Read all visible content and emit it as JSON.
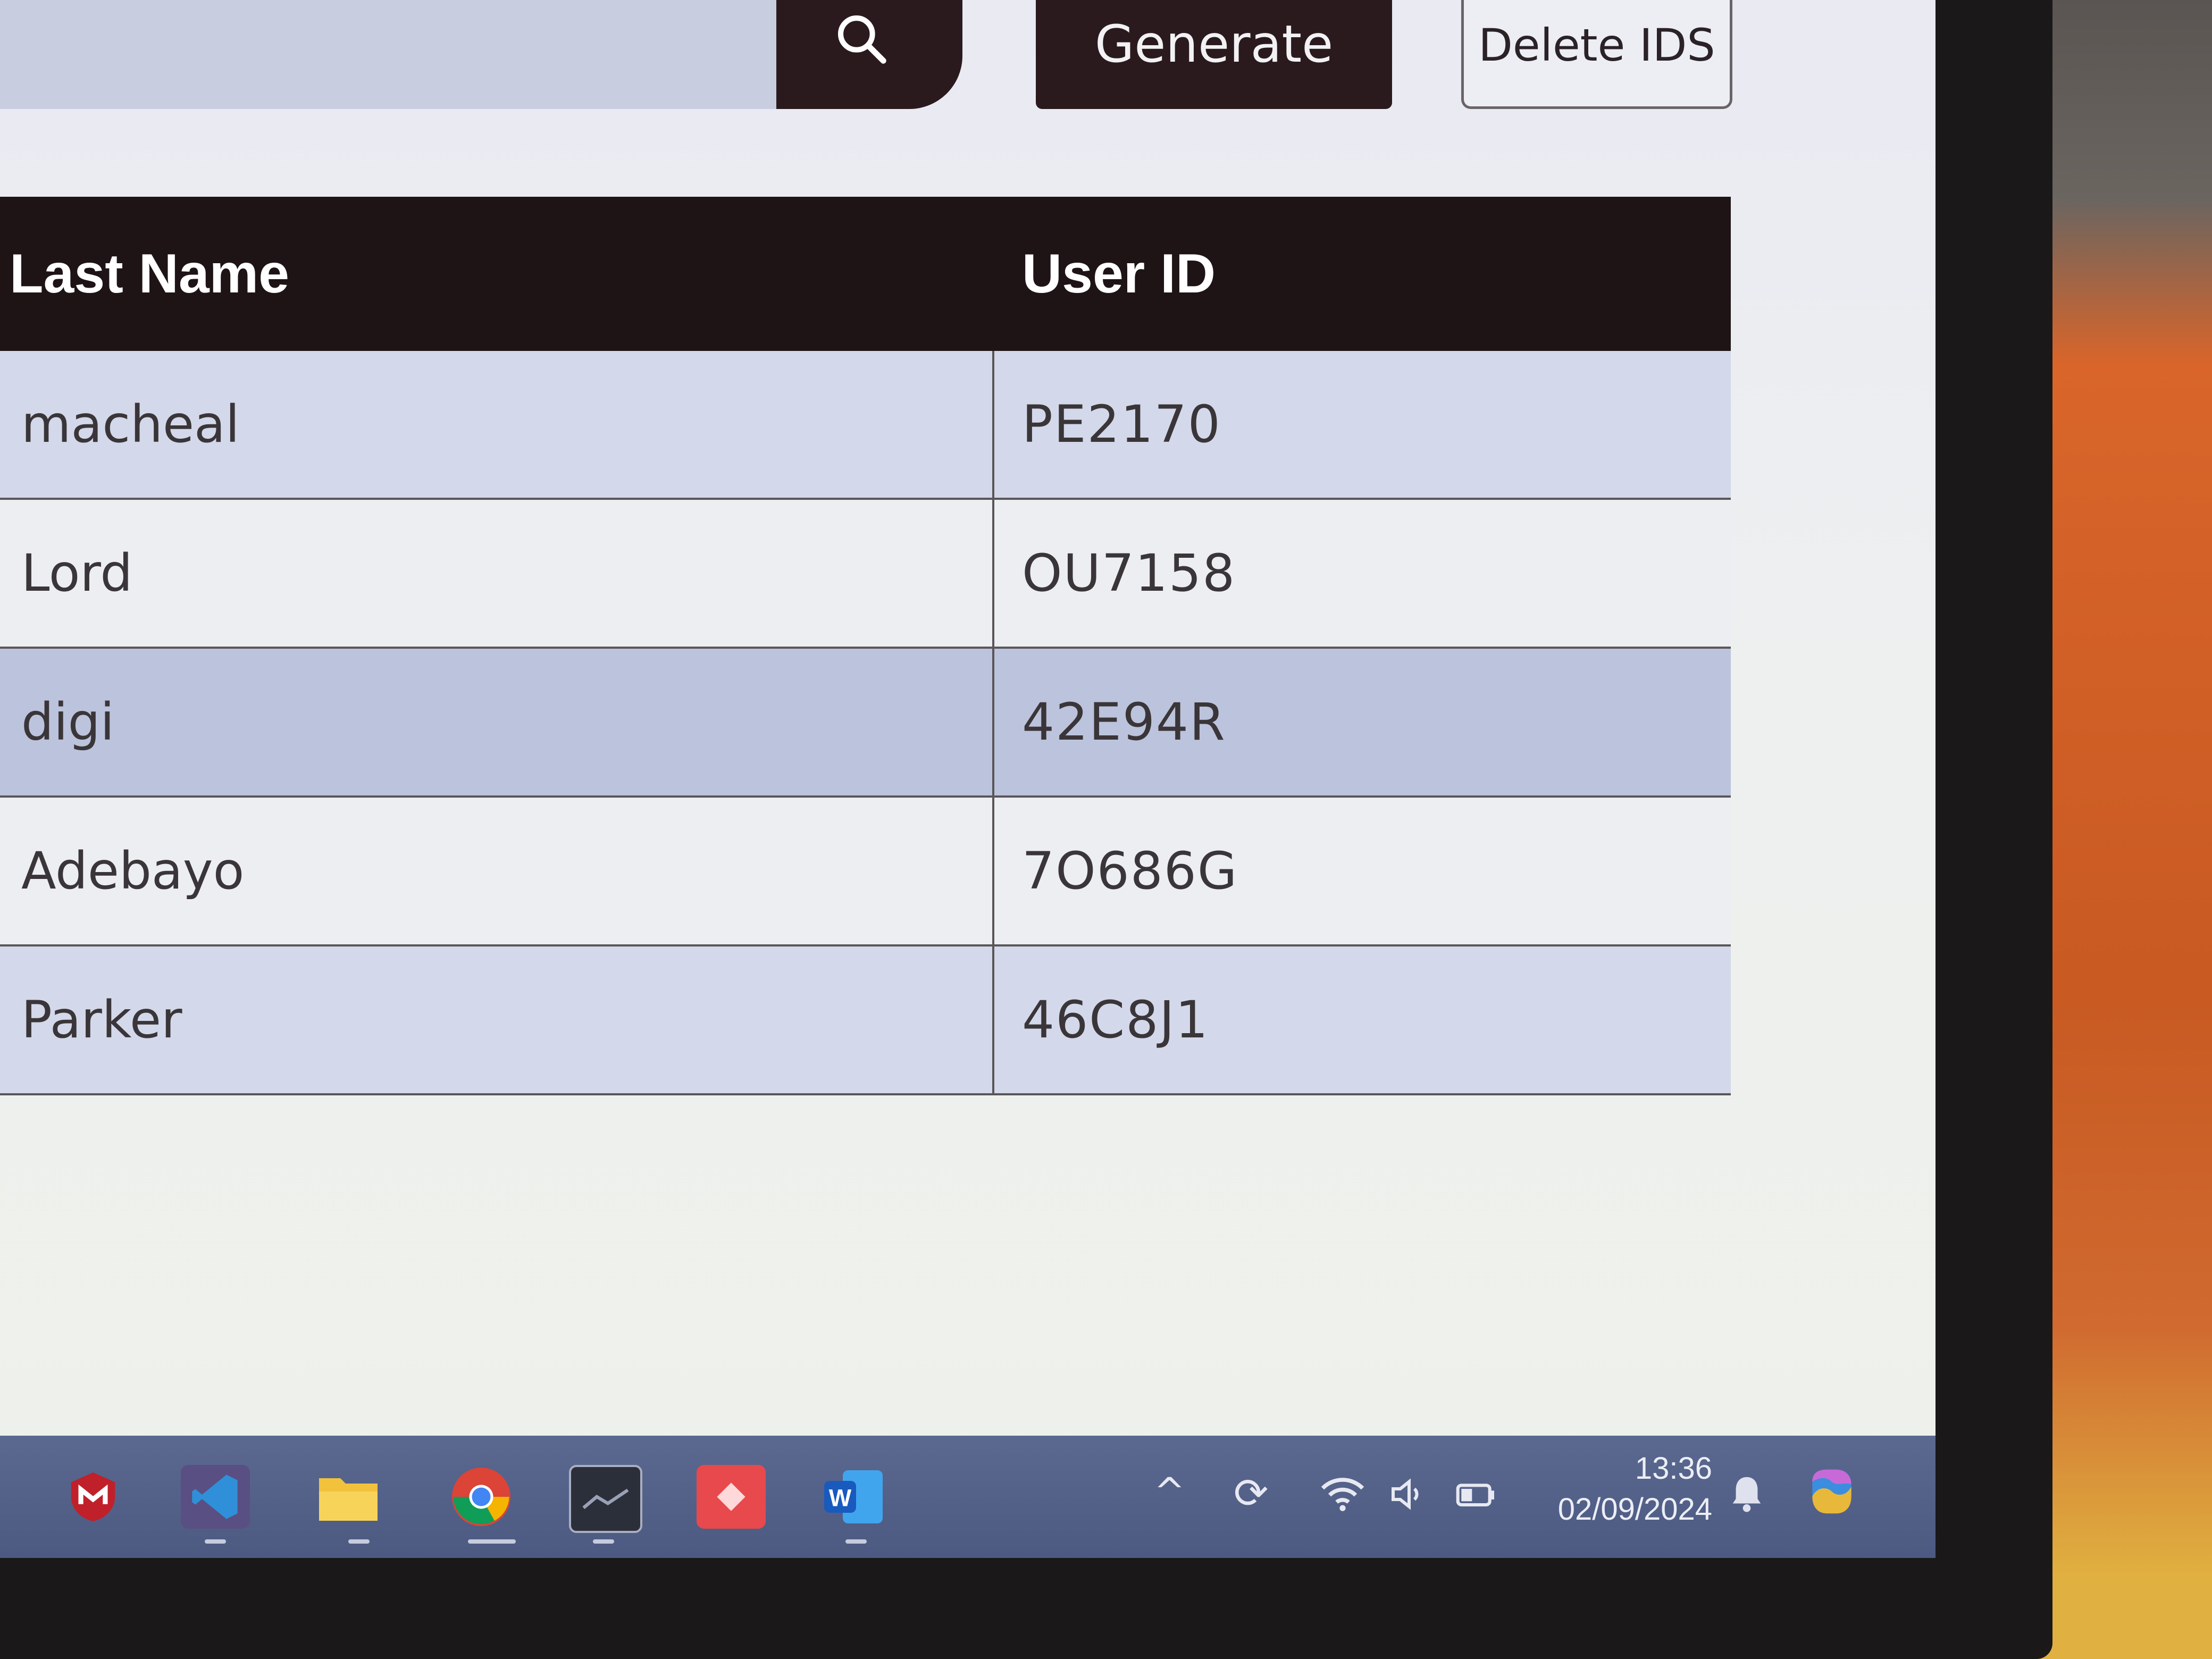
{
  "toolbar": {
    "generate_label": "Generate",
    "delete_label": "Delete IDS"
  },
  "table": {
    "headers": {
      "last_name": "Last Name",
      "user_id": "User ID"
    },
    "rows": [
      {
        "last_name": "macheal",
        "user_id": "PE2170"
      },
      {
        "last_name": "Lord",
        "user_id": "OU7158"
      },
      {
        "last_name": "digi",
        "user_id": "42E94R"
      },
      {
        "last_name": "Adebayo",
        "user_id": "7O686G"
      },
      {
        "last_name": "Parker",
        "user_id": "46C8J1"
      }
    ]
  },
  "taskbar": {
    "apps": [
      "mcafee-icon",
      "vscode-icon",
      "file-explorer-icon",
      "chrome-icon",
      "terminal-icon",
      "app-icon",
      "word-icon"
    ],
    "clock": {
      "time": "13:36",
      "date": "02/09/2024"
    }
  },
  "colors": {
    "header_bg": "#1e1416",
    "button_dark": "#2a1a1e",
    "row_alt": "#d3d8ea",
    "row_selected": "#bcc3dc",
    "taskbar": "#4c5a82"
  }
}
